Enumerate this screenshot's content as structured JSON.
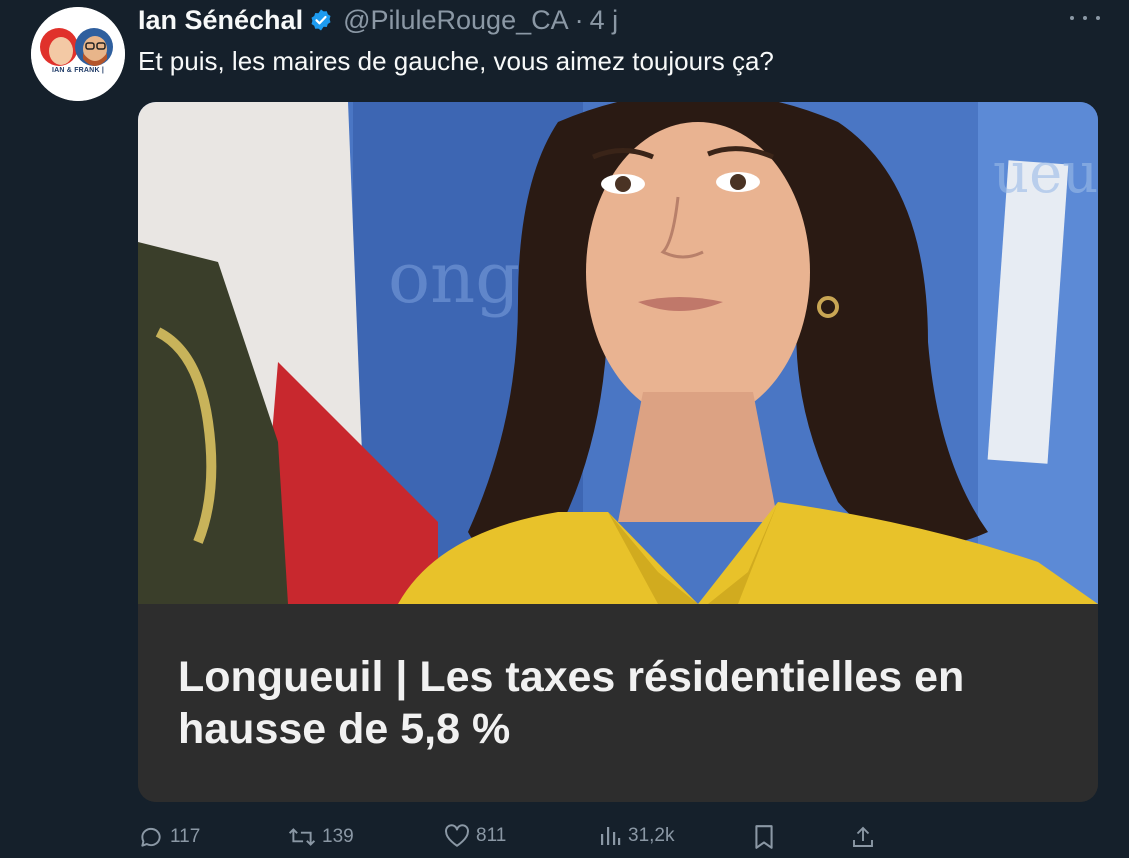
{
  "tweet": {
    "display_name": "Ian Sénéchal",
    "handle": "@PiluleRouge_CA",
    "separator": "·",
    "time": "4 j",
    "text": "Et puis, les maires de gauche, vous aimez toujours ça?",
    "avatar_label": "IAN & FRANK |"
  },
  "card": {
    "headline": "Longueuil | Les taxes résidentielles en hausse de 5,8 %"
  },
  "actions": {
    "replies": "117",
    "retweets": "139",
    "likes": "811",
    "views": "31,2k"
  },
  "icons": {
    "verified": "verified-badge-icon",
    "more": "more-icon",
    "reply": "reply-icon",
    "retweet": "retweet-icon",
    "like": "heart-icon",
    "views": "views-icon",
    "bookmark": "bookmark-icon",
    "share": "share-icon"
  },
  "colors": {
    "background": "#15202b",
    "text": "#f7f9f9",
    "muted": "#8b98a5",
    "verified": "#1d9bf0",
    "card_caption_bg": "#2d2d2d"
  }
}
